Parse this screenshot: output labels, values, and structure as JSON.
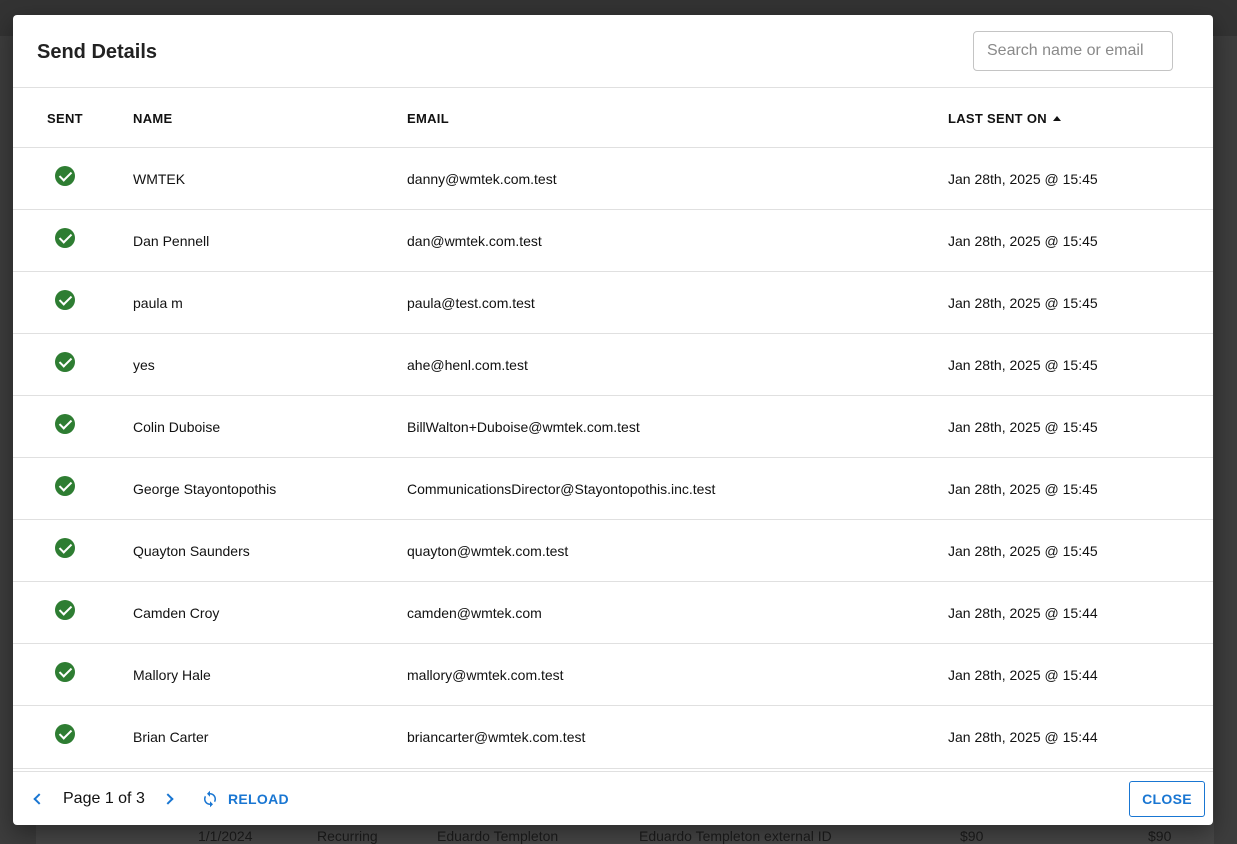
{
  "background_row": [
    "1/1/2024",
    "Recurring",
    "Eduardo Templeton",
    "Eduardo Templeton external ID",
    "$90",
    "$90"
  ],
  "modal": {
    "title": "Send Details",
    "search": {
      "placeholder": "Search name or email",
      "value": ""
    }
  },
  "table": {
    "columns": {
      "sent": "SENT",
      "name": "NAME",
      "email": "EMAIL",
      "last_sent_on": "LAST SENT ON"
    },
    "sort": {
      "column": "last_sent_on",
      "direction": "ascending"
    },
    "rows": [
      {
        "sent": true,
        "name": "WMTEK",
        "email": "danny@wmtek.com.test",
        "last_sent_on": "Jan 28th, 2025 @ 15:45"
      },
      {
        "sent": true,
        "name": "Dan Pennell",
        "email": "dan@wmtek.com.test",
        "last_sent_on": "Jan 28th, 2025 @ 15:45"
      },
      {
        "sent": true,
        "name": "paula m",
        "email": "paula@test.com.test",
        "last_sent_on": "Jan 28th, 2025 @ 15:45"
      },
      {
        "sent": true,
        "name": "yes",
        "email": "ahe@henl.com.test",
        "last_sent_on": "Jan 28th, 2025 @ 15:45"
      },
      {
        "sent": true,
        "name": "Colin Duboise",
        "email": "BillWalton+Duboise@wmtek.com.test",
        "last_sent_on": "Jan 28th, 2025 @ 15:45"
      },
      {
        "sent": true,
        "name": "George Stayontopothis",
        "email": "CommunicationsDirector@Stayontopothis.inc.test",
        "last_sent_on": "Jan 28th, 2025 @ 15:45"
      },
      {
        "sent": true,
        "name": "Quayton Saunders",
        "email": "quayton@wmtek.com.test",
        "last_sent_on": "Jan 28th, 2025 @ 15:45"
      },
      {
        "sent": true,
        "name": "Camden Croy",
        "email": "camden@wmtek.com",
        "last_sent_on": "Jan 28th, 2025 @ 15:44"
      },
      {
        "sent": true,
        "name": "Mallory Hale",
        "email": "mallory@wmtek.com.test",
        "last_sent_on": "Jan 28th, 2025 @ 15:44"
      },
      {
        "sent": true,
        "name": "Brian Carter",
        "email": "briancarter@wmtek.com.test",
        "last_sent_on": "Jan 28th, 2025 @ 15:44"
      }
    ]
  },
  "footer": {
    "page_label": "Page 1 of 3",
    "reload_label": "RELOAD",
    "close_label": "CLOSE"
  },
  "colors": {
    "accent": "#1976d2",
    "sent_check": "#2e7d32"
  },
  "icons": {
    "prev": "chevron-left-icon",
    "next": "chevron-right-icon",
    "reload": "refresh-icon",
    "sent": "check-circle-icon",
    "sort": "sort-ascending-icon"
  }
}
